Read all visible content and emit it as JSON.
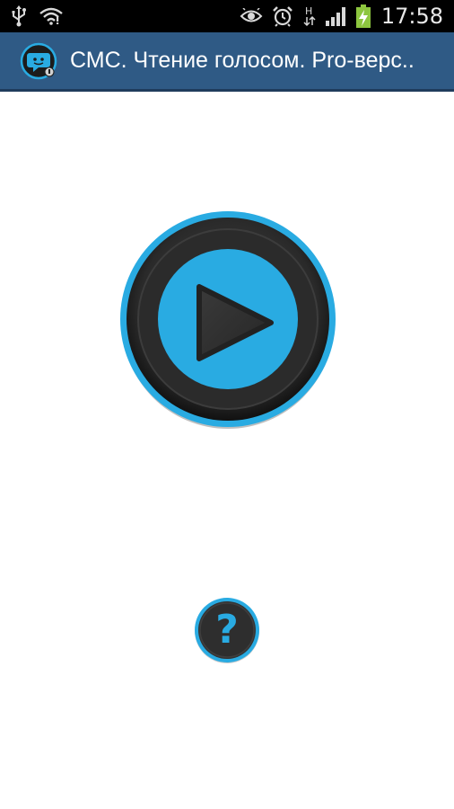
{
  "status_bar": {
    "icons": [
      "usb-icon",
      "wifi-warning-icon",
      "eye-icon",
      "alarm-icon",
      "hspa-icon",
      "signal-icon",
      "battery-charging-icon"
    ],
    "time": "17:58"
  },
  "action_bar": {
    "app_icon": "sms-robot-icon",
    "title": "СМС. Чтение голосом. Pro-верс.."
  },
  "main": {
    "play_button_icon": "play-icon",
    "help_button_icon": "question-icon",
    "help_glyph": "?"
  },
  "colors": {
    "accent": "#29abe2",
    "action_bar": "#2f5a85",
    "button_dark": "#2b2b2b"
  }
}
